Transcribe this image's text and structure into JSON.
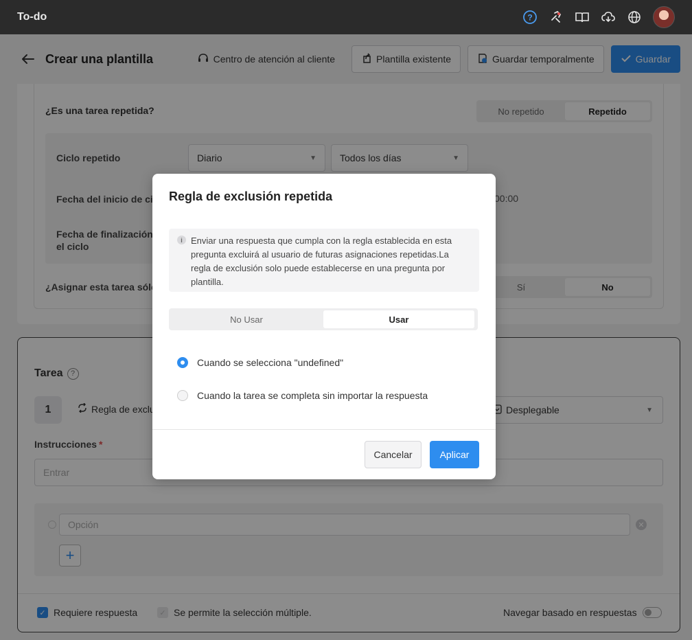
{
  "appbar": {
    "title": "To-do"
  },
  "header": {
    "title": "Crear una plantilla",
    "support_label": "Centro de atención al cliente",
    "existing_label": "Plantilla existente",
    "temp_save_label": "Guardar temporalmente",
    "save_label": "Guardar"
  },
  "repeat": {
    "question": "¿Es una tarea repetida?",
    "options": [
      "No repetido",
      "Repetido"
    ],
    "selected": "Repetido",
    "cycle_label": "Ciclo repetido",
    "cycle_value": "Diario",
    "cycle_days": "Todos los días",
    "start_label": "Fecha del inicio de cic",
    "start_time": "00:00",
    "end_label_1": "Fecha de finalización",
    "end_label_2": "el ciclo",
    "assign_question": "¿Asignar esta tarea sólo",
    "assign_options": [
      "Sí",
      "No"
    ],
    "assign_selected": "No"
  },
  "task": {
    "title": "Tarea",
    "number": "1",
    "rule_fragment": "Regla de exclu",
    "type_value": "Desplegable",
    "instructions_label": "Instrucciones",
    "required_mark": "*",
    "instructions_placeholder": "Entrar",
    "option_placeholder": "Opción",
    "add_label": "+",
    "requires_answer_label": "Requiere respuesta",
    "multi_select_label": "Se permite la selección múltiple.",
    "navigate_label": "Navegar basado en respuestas"
  },
  "modal": {
    "title": "Regla de exclusión repetida",
    "info_text": "Enviar una respuesta que cumpla con la regla establecida en esta pregunta excluirá al usuario de futuras asignaciones repetidas.La regla de exclusión solo puede establecerse en una pregunta por plantilla.",
    "info_icon": "i",
    "toggle_options": [
      "No Usar",
      "Usar"
    ],
    "toggle_selected": "Usar",
    "radio_1": "Cuando se selecciona \"undefined\"",
    "radio_2": "Cuando la tarea se completa sin importar la respuesta",
    "radio_selected": 1,
    "cancel_label": "Cancelar",
    "apply_label": "Aplicar"
  },
  "colors": {
    "accent": "#2e8def",
    "appbar": "#2b2b2b",
    "overlay": "rgba(0,0,0,0.45)"
  },
  "icons": [
    "help-icon",
    "tools-icon",
    "book-icon",
    "cloud-download-icon",
    "globe-icon",
    "avatar",
    "back-arrow-icon",
    "support-icon",
    "copy-icon",
    "temp-save-icon",
    "check-icon",
    "repeat-icon",
    "dropdown-icon",
    "info-icon"
  ]
}
